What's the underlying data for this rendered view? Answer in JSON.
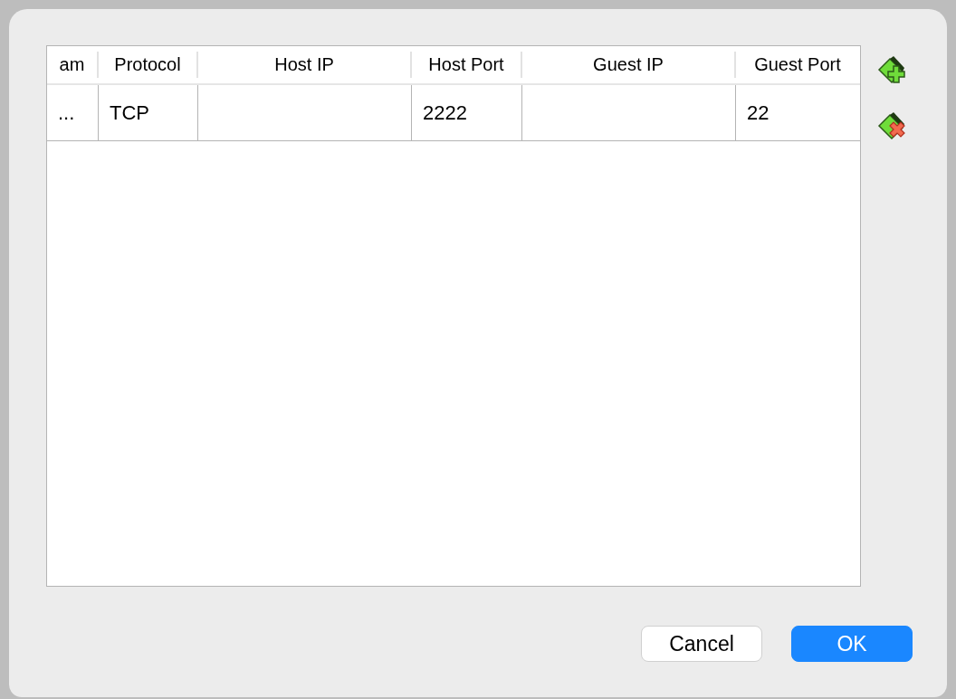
{
  "table": {
    "columns": [
      {
        "label": "am"
      },
      {
        "label": "Protocol"
      },
      {
        "label": "Host IP"
      },
      {
        "label": "Host Port"
      },
      {
        "label": "Guest IP"
      },
      {
        "label": "Guest Port"
      }
    ],
    "rows": [
      {
        "cells": [
          "...",
          "TCP",
          "",
          "2222",
          "",
          "22"
        ]
      }
    ]
  },
  "tools": [
    {
      "kind": "add"
    },
    {
      "kind": "remove"
    }
  ],
  "buttons": [
    {
      "label": "Cancel",
      "kind": "secondary"
    },
    {
      "label": "OK",
      "kind": "primary"
    }
  ]
}
